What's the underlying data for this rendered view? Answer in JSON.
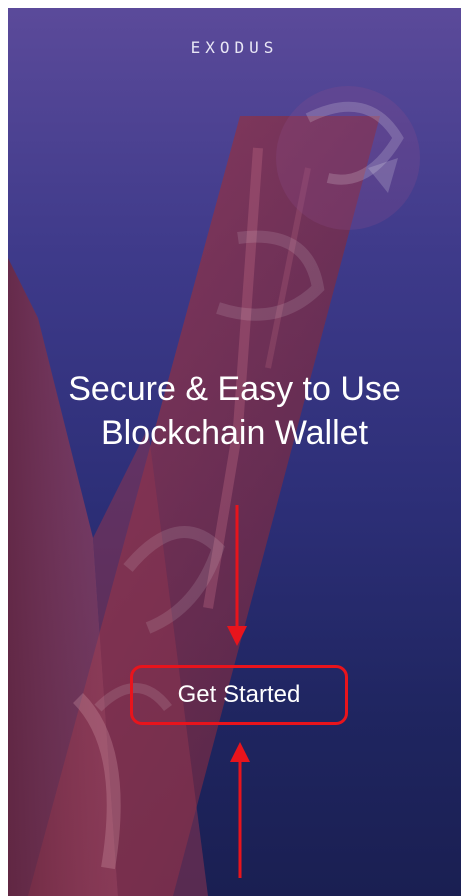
{
  "app": {
    "logo_text": "EXODUS"
  },
  "welcome": {
    "headline_line1": "Secure & Easy to Use",
    "headline_line2": "Blockchain Wallet",
    "cta_label": "Get Started"
  },
  "icons": {
    "annotation_arrow_down": "arrow-down-icon",
    "annotation_arrow_up": "arrow-up-icon"
  },
  "colors": {
    "background_top": "#5b4a9a",
    "background_bottom": "#1a1f52",
    "annotation_red": "#e8141c",
    "text": "#ffffff"
  }
}
